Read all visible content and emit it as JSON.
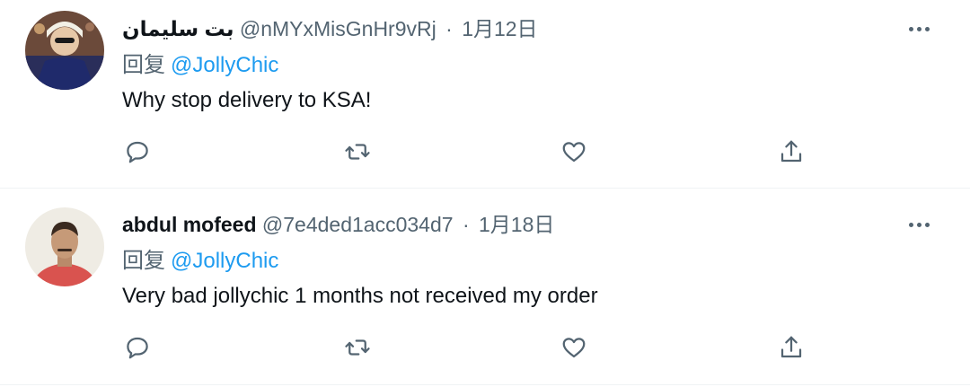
{
  "tweets": [
    {
      "display_name": "بت سليمان",
      "handle": "@nMYxMisGnHr9vRj",
      "separator": "·",
      "date": "1月12日",
      "reply_prefix": "回复",
      "reply_to": "@JollyChic",
      "text": "Why stop delivery to KSA!"
    },
    {
      "display_name": "abdul mofeed",
      "handle": "@7e4ded1acc034d7",
      "separator": "·",
      "date": "1月18日",
      "reply_prefix": "回复",
      "reply_to": "@JollyChic",
      "text": "Very bad jollychic 1 months not received my order"
    }
  ],
  "icons": {
    "reply": "reply-icon",
    "retweet": "retweet-icon",
    "like": "heart-icon",
    "share": "share-icon",
    "more": "more-icon"
  },
  "colors": {
    "text": "#0f1419",
    "secondary": "#536471",
    "link": "#1d9bf0",
    "divider": "#eff3f4"
  }
}
